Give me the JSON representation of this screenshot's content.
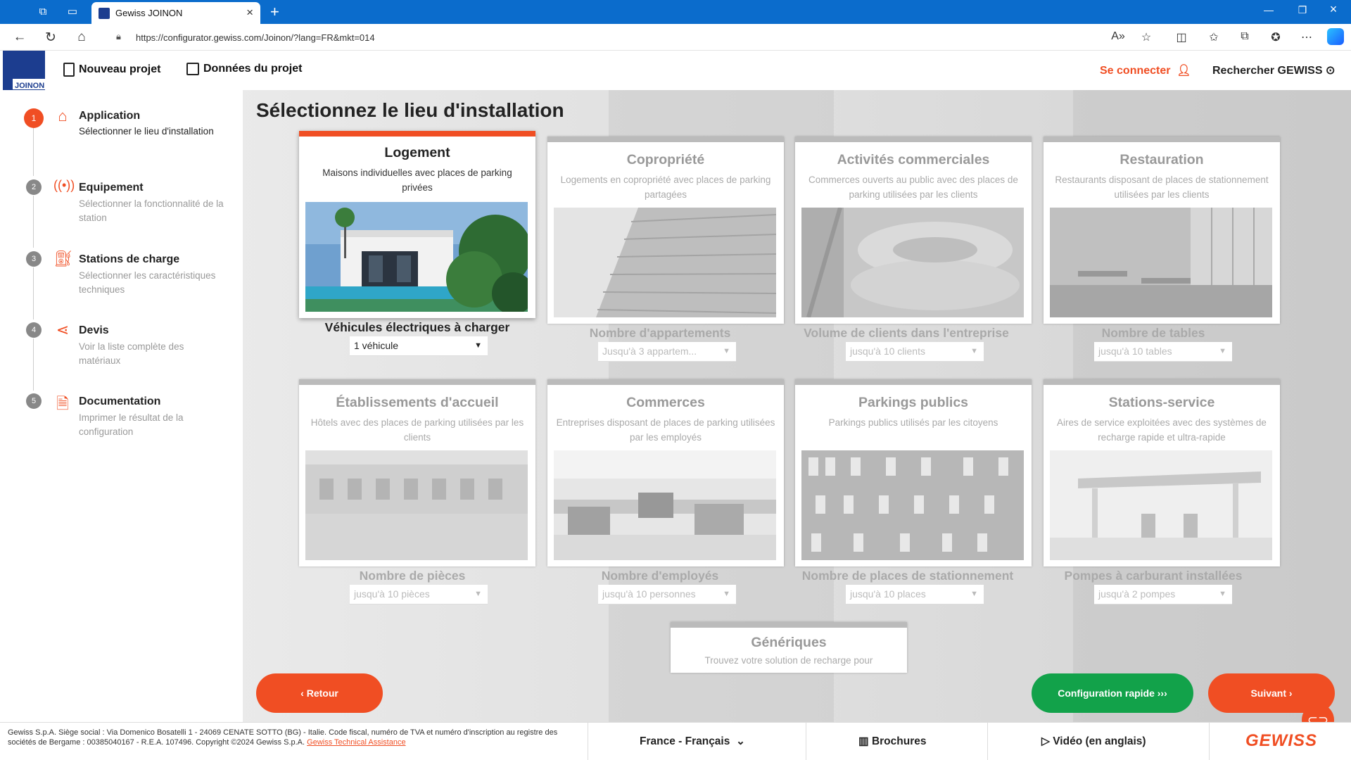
{
  "browser": {
    "tab_title": "Gewiss JOINON",
    "url": "https://configurator.gewiss.com/Joinon/?lang=FR&mkt=014"
  },
  "header": {
    "logo_text": "JOINON",
    "nouveau_projet": "Nouveau projet",
    "donnees_projet": "Données du projet",
    "se_connecter": "Se connecter",
    "rechercher": "Rechercher GEWISS"
  },
  "steps": [
    {
      "num": "1",
      "title": "Application",
      "sub": "Sélectionner le lieu d'installation"
    },
    {
      "num": "2",
      "title": "Equipement",
      "sub": "Sélectionner la fonctionnalité de la station"
    },
    {
      "num": "3",
      "title": "Stations de charge",
      "sub": "Sélectionner les caractéristiques techniques"
    },
    {
      "num": "4",
      "title": "Devis",
      "sub": "Voir la liste complète des matériaux"
    },
    {
      "num": "5",
      "title": "Documentation",
      "sub": "Imprimer le résultat de la configuration"
    }
  ],
  "main": {
    "title": "Sélectionnez le lieu d'installation",
    "cards": [
      {
        "title": "Logement",
        "desc": "Maisons individuelles avec places de parking privées",
        "question": "Véhicules électriques à charger",
        "value": "1 véhicule"
      },
      {
        "title": "Copropriété",
        "desc": "Logements en copropriété avec places de parking partagées",
        "question": "Nombre d'appartements",
        "value": "Jusqu'à 3 appartem..."
      },
      {
        "title": "Activités commerciales",
        "desc": "Commerces ouverts au public avec des places de parking utilisées par les clients",
        "question": "Volume de clients dans l'entreprise",
        "value": "jusqu'à 10 clients"
      },
      {
        "title": "Restauration",
        "desc": "Restaurants disposant de places de stationnement utilisées par les clients",
        "question": "Nombre de tables",
        "value": "jusqu'à 10 tables"
      },
      {
        "title": "Établissements d'accueil",
        "desc": "Hôtels avec des places de parking utilisées par les clients",
        "question": "Nombre de pièces",
        "value": "jusqu'à 10 pièces"
      },
      {
        "title": "Commerces",
        "desc": "Entreprises disposant de places de parking utilisées par les employés",
        "question": "Nombre d'employés",
        "value": "jusqu'à 10 personnes"
      },
      {
        "title": "Parkings publics",
        "desc": "Parkings publics utilisés par les citoyens",
        "question": "Nombre de places de stationnement",
        "value": "jusqu'à 10 places"
      },
      {
        "title": "Stations-service",
        "desc": "Aires de service exploitées avec des systèmes de recharge rapide et ultra-rapide",
        "question": "Pompes à carburant installées",
        "value": "jusqu'à 2 pompes"
      }
    ],
    "generic": {
      "title": "Génériques",
      "desc": "Trouvez votre solution de recharge pour"
    }
  },
  "buttons": {
    "retour": "‹ Retour",
    "config_rapide": "Configuration rapide ›››",
    "suivant": "Suivant ›"
  },
  "footer": {
    "legal": "Gewiss S.p.A. Siège social : Via Domenico Bosatelli 1 - 24069 CENATE SOTTO (BG) - Italie. Code fiscal, numéro de TVA et numéro d'inscription au registre des sociétés de Bergame : 00385040167 - R.E.A. 107496. Copyright ©2024 Gewiss S.p.A.",
    "legal_link": "Gewiss Technical Assistance",
    "locale": "France - Français",
    "brochures": "Brochures",
    "video": "Vidéo (en anglais)",
    "brand": "GEWISS"
  }
}
